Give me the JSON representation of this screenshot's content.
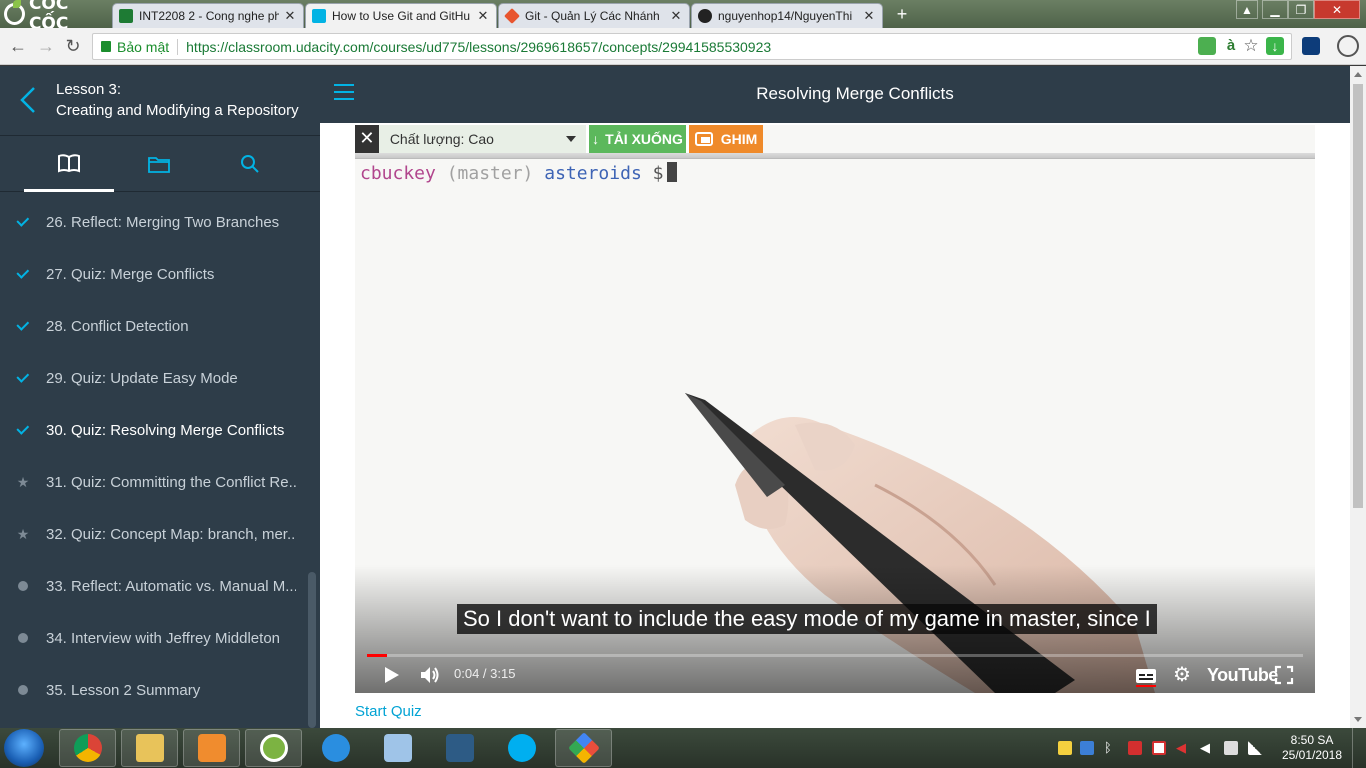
{
  "browser": {
    "brand": "CỐC CỐC",
    "tabs": [
      {
        "title": "INT2208 2 - Cong nghe ph",
        "favicon_color": "#1e7b34"
      },
      {
        "title": "How to Use Git and GitHu",
        "favicon_color": "#02b3e4"
      },
      {
        "title": "Git - Quản Lý Các Nhánh",
        "favicon_color": "#e8552f"
      },
      {
        "title": "nguyenhop14/NguyenThi",
        "favicon_color": "#222222"
      }
    ],
    "secure_label": "Bảo mật",
    "url": "https://classroom.udacity.com/courses/ud775/lessons/2969618657/concepts/29941585530923"
  },
  "sidebar": {
    "lesson_number": "Lesson 3:",
    "lesson_name": "Creating and Modifying a Repository",
    "concepts": [
      {
        "label": "26. Reflect: Merging Two Branches",
        "status": "done"
      },
      {
        "label": "27. Quiz: Merge Conflicts",
        "status": "done"
      },
      {
        "label": "28. Conflict Detection",
        "status": "done"
      },
      {
        "label": "29. Quiz: Update Easy Mode",
        "status": "done"
      },
      {
        "label": "30. Quiz: Resolving Merge Conflicts",
        "status": "current"
      },
      {
        "label": "31. Quiz: Committing the Conflict Re...",
        "status": "star"
      },
      {
        "label": "32. Quiz: Concept Map: branch, mer...",
        "status": "star"
      },
      {
        "label": "33. Reflect: Automatic vs. Manual M...",
        "status": "dot"
      },
      {
        "label": "34. Interview with Jeffrey Middleton",
        "status": "dot"
      },
      {
        "label": "35. Lesson 2 Summary",
        "status": "dot"
      }
    ]
  },
  "main": {
    "concept_title": "Resolving Merge Conflicts",
    "video": {
      "quality_label": "Chất lượng: Cao",
      "download_label": "TẢI XUỐNG",
      "pin_label": "GHIM",
      "prompt_user": "cbuckey",
      "prompt_branch": "(master)",
      "prompt_dir": "asteroids",
      "prompt_symbol": "$",
      "caption": "So I don't want to include the easy mode of my game in master, since I",
      "time": "0:04 / 3:15",
      "progress_fraction": 0.021,
      "logo": "YouTube"
    },
    "start_quiz_label": "Start Quiz"
  },
  "taskbar": {
    "time": "8:50 SA",
    "date": "25/01/2018"
  },
  "colors": {
    "udacity_dark": "#2e3d49",
    "udacity_blue": "#02b3e4",
    "download_green": "#5cb85c",
    "pin_orange": "#ef8a2a"
  }
}
